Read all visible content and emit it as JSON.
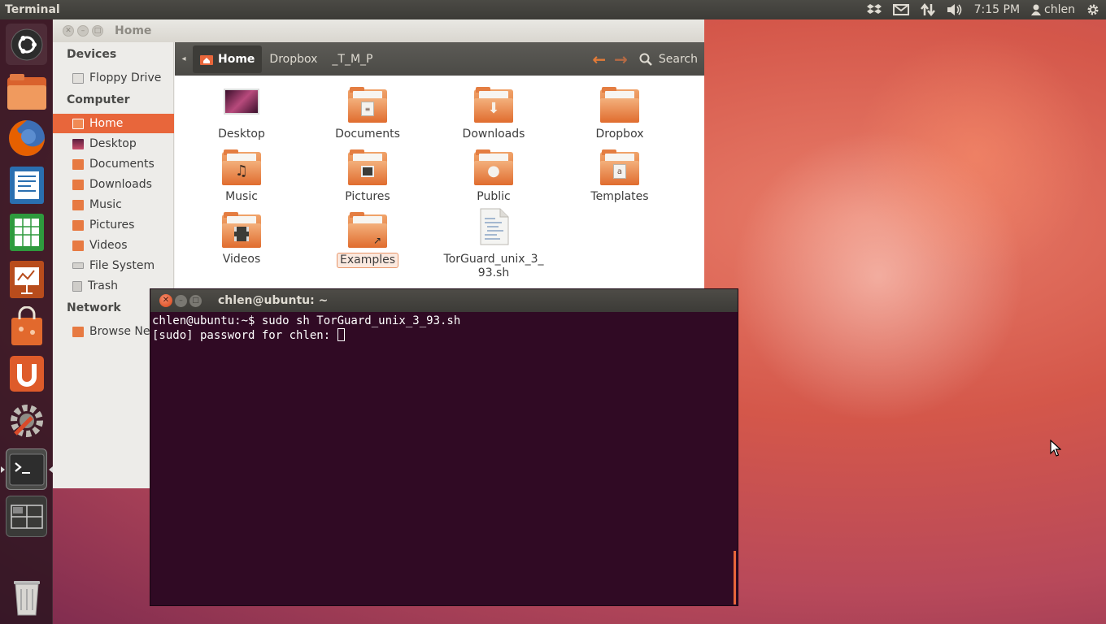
{
  "top_panel": {
    "app_name": "Terminal",
    "clock": "7:15 PM",
    "user": "chlen",
    "indicators": [
      "dropbox-icon",
      "mail-icon",
      "network-icon",
      "volume-icon",
      "user-icon",
      "gear-icon"
    ]
  },
  "launcher": {
    "items": [
      "ubuntu-dash",
      "files",
      "firefox",
      "libreoffice-writer",
      "libreoffice-calc",
      "libreoffice-impress",
      "ubuntu-software-center",
      "ubuntu-one",
      "system-settings",
      "terminal",
      "workspace-switcher",
      "trash"
    ]
  },
  "file_manager": {
    "window_title": "Home",
    "breadcrumbs": [
      "Home",
      "Dropbox",
      "_T_M_P"
    ],
    "search_label": "Search",
    "sidebar": {
      "devices_heading": "Devices",
      "devices": [
        "Floppy Drive"
      ],
      "computer_heading": "Computer",
      "computer": [
        "Home",
        "Desktop",
        "Documents",
        "Downloads",
        "Music",
        "Pictures",
        "Videos",
        "File System",
        "Trash"
      ],
      "network_heading": "Network",
      "network": [
        "Browse Network"
      ]
    },
    "files": [
      {
        "name": "Desktop"
      },
      {
        "name": "Documents"
      },
      {
        "name": "Downloads"
      },
      {
        "name": "Dropbox"
      },
      {
        "name": "Music"
      },
      {
        "name": "Pictures"
      },
      {
        "name": "Public"
      },
      {
        "name": "Templates"
      },
      {
        "name": "Videos"
      },
      {
        "name": "Examples"
      },
      {
        "name": "TorGuard_unix_3_93.sh",
        "line1": "TorGuard_unix_3_",
        "line2": "93.sh"
      }
    ]
  },
  "terminal": {
    "window_title": "chlen@ubuntu: ~",
    "lines": [
      "chlen@ubuntu:~$ sudo sh TorGuard_unix_3_93.sh",
      "[sudo] password for chlen: "
    ]
  },
  "colors": {
    "accent": "#e8663b",
    "terminal_bg": "#300a24",
    "panel_bg": "#3c3b37"
  }
}
